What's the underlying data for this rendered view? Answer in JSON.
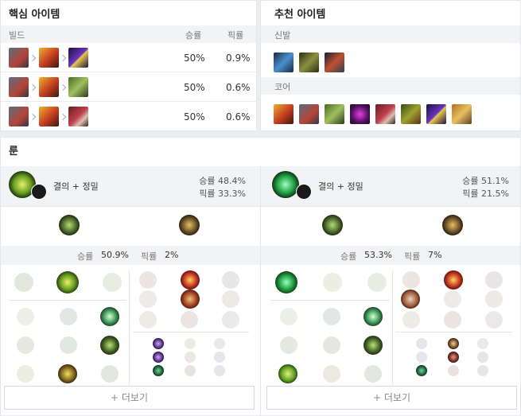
{
  "core_items": {
    "title": "핵심 아이템",
    "header": {
      "build": "빌드",
      "winrate": "승률",
      "pickrate": "픽률"
    },
    "rows": [
      {
        "winrate": "50%",
        "pickrate": "0.9%",
        "items": [
          "sword-item-icon",
          "armor-item-icon",
          "blade-item-icon"
        ]
      },
      {
        "winrate": "50%",
        "pickrate": "0.6%",
        "items": [
          "sword-item-icon",
          "armor-item-icon",
          "titan-item-icon"
        ]
      },
      {
        "winrate": "50%",
        "pickrate": "0.6%",
        "items": [
          "sword-item-icon",
          "armor-item-icon",
          "mask-item-icon"
        ]
      }
    ]
  },
  "rec_items": {
    "title": "추천 아이템",
    "boots_label": "신발",
    "core_label": "코어",
    "boots": [
      "ionian-boots-icon",
      "mercury-boots-icon",
      "plated-boots-icon"
    ],
    "core": [
      "armor-item-icon",
      "sword-item-icon",
      "titan-item-icon",
      "void-item-icon",
      "mask-item-icon",
      "relic-item-icon",
      "blade-item-icon",
      "helm-item-icon"
    ]
  },
  "runes": {
    "title": "룬",
    "pages": [
      {
        "name": "결의 + 정밀",
        "winrate_label": "승률",
        "winrate": "48.4%",
        "pickrate_label": "픽률",
        "pickrate": "33.3%",
        "keystone": "grasp-rune-icon",
        "stat_winrate_label": "승률",
        "stat_winrate": "50.9%",
        "stat_pickrate_label": "픽률",
        "stat_pickrate": "2%",
        "more": "+ 더보기"
      },
      {
        "name": "결의 + 정밀",
        "winrate_label": "승률",
        "winrate": "51.1%",
        "pickrate_label": "픽률",
        "pickrate": "21.5%",
        "keystone": "aftershock-rune-icon",
        "stat_winrate_label": "승률",
        "stat_winrate": "53.3%",
        "stat_pickrate_label": "픽률",
        "stat_pickrate": "7%",
        "more": "+ 더보기"
      }
    ]
  },
  "colors": {
    "resolve": "#7ec94a",
    "precision": "#c9a44a",
    "accent": "#2b2b2b"
  }
}
